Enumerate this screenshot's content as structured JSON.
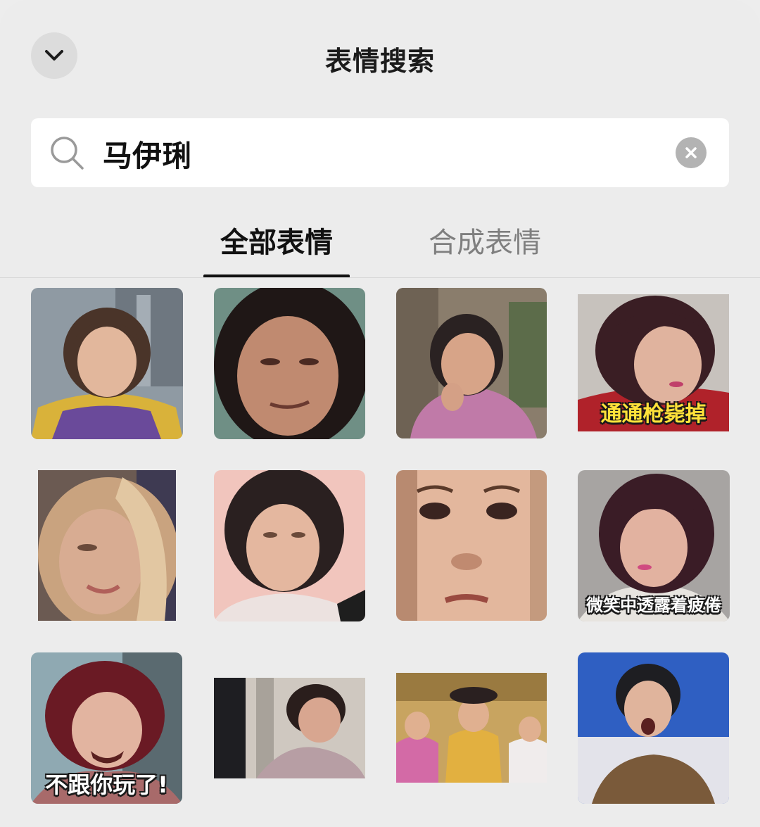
{
  "header": {
    "title": "表情搜索",
    "collapse_icon": "chevron-down-icon"
  },
  "search": {
    "query": "马伊琍",
    "search_icon": "search-icon",
    "clear_icon": "clear-circle-icon"
  },
  "tabs": [
    {
      "label": "全部表情",
      "active": true
    },
    {
      "label": "合成表情",
      "active": false
    }
  ],
  "stickers": [
    {
      "caption": ""
    },
    {
      "caption": ""
    },
    {
      "caption": ""
    },
    {
      "caption": "通通枪毙掉"
    },
    {
      "caption": ""
    },
    {
      "caption": ""
    },
    {
      "caption": ""
    },
    {
      "caption": "微笑中透露着疲倦"
    },
    {
      "caption": "不跟你玩了!"
    },
    {
      "caption": ""
    },
    {
      "caption": ""
    },
    {
      "caption": ""
    }
  ],
  "colors": {
    "background": "#ececec",
    "text_primary": "#1b1b1b",
    "tab_inactive": "#7f7f7f"
  }
}
